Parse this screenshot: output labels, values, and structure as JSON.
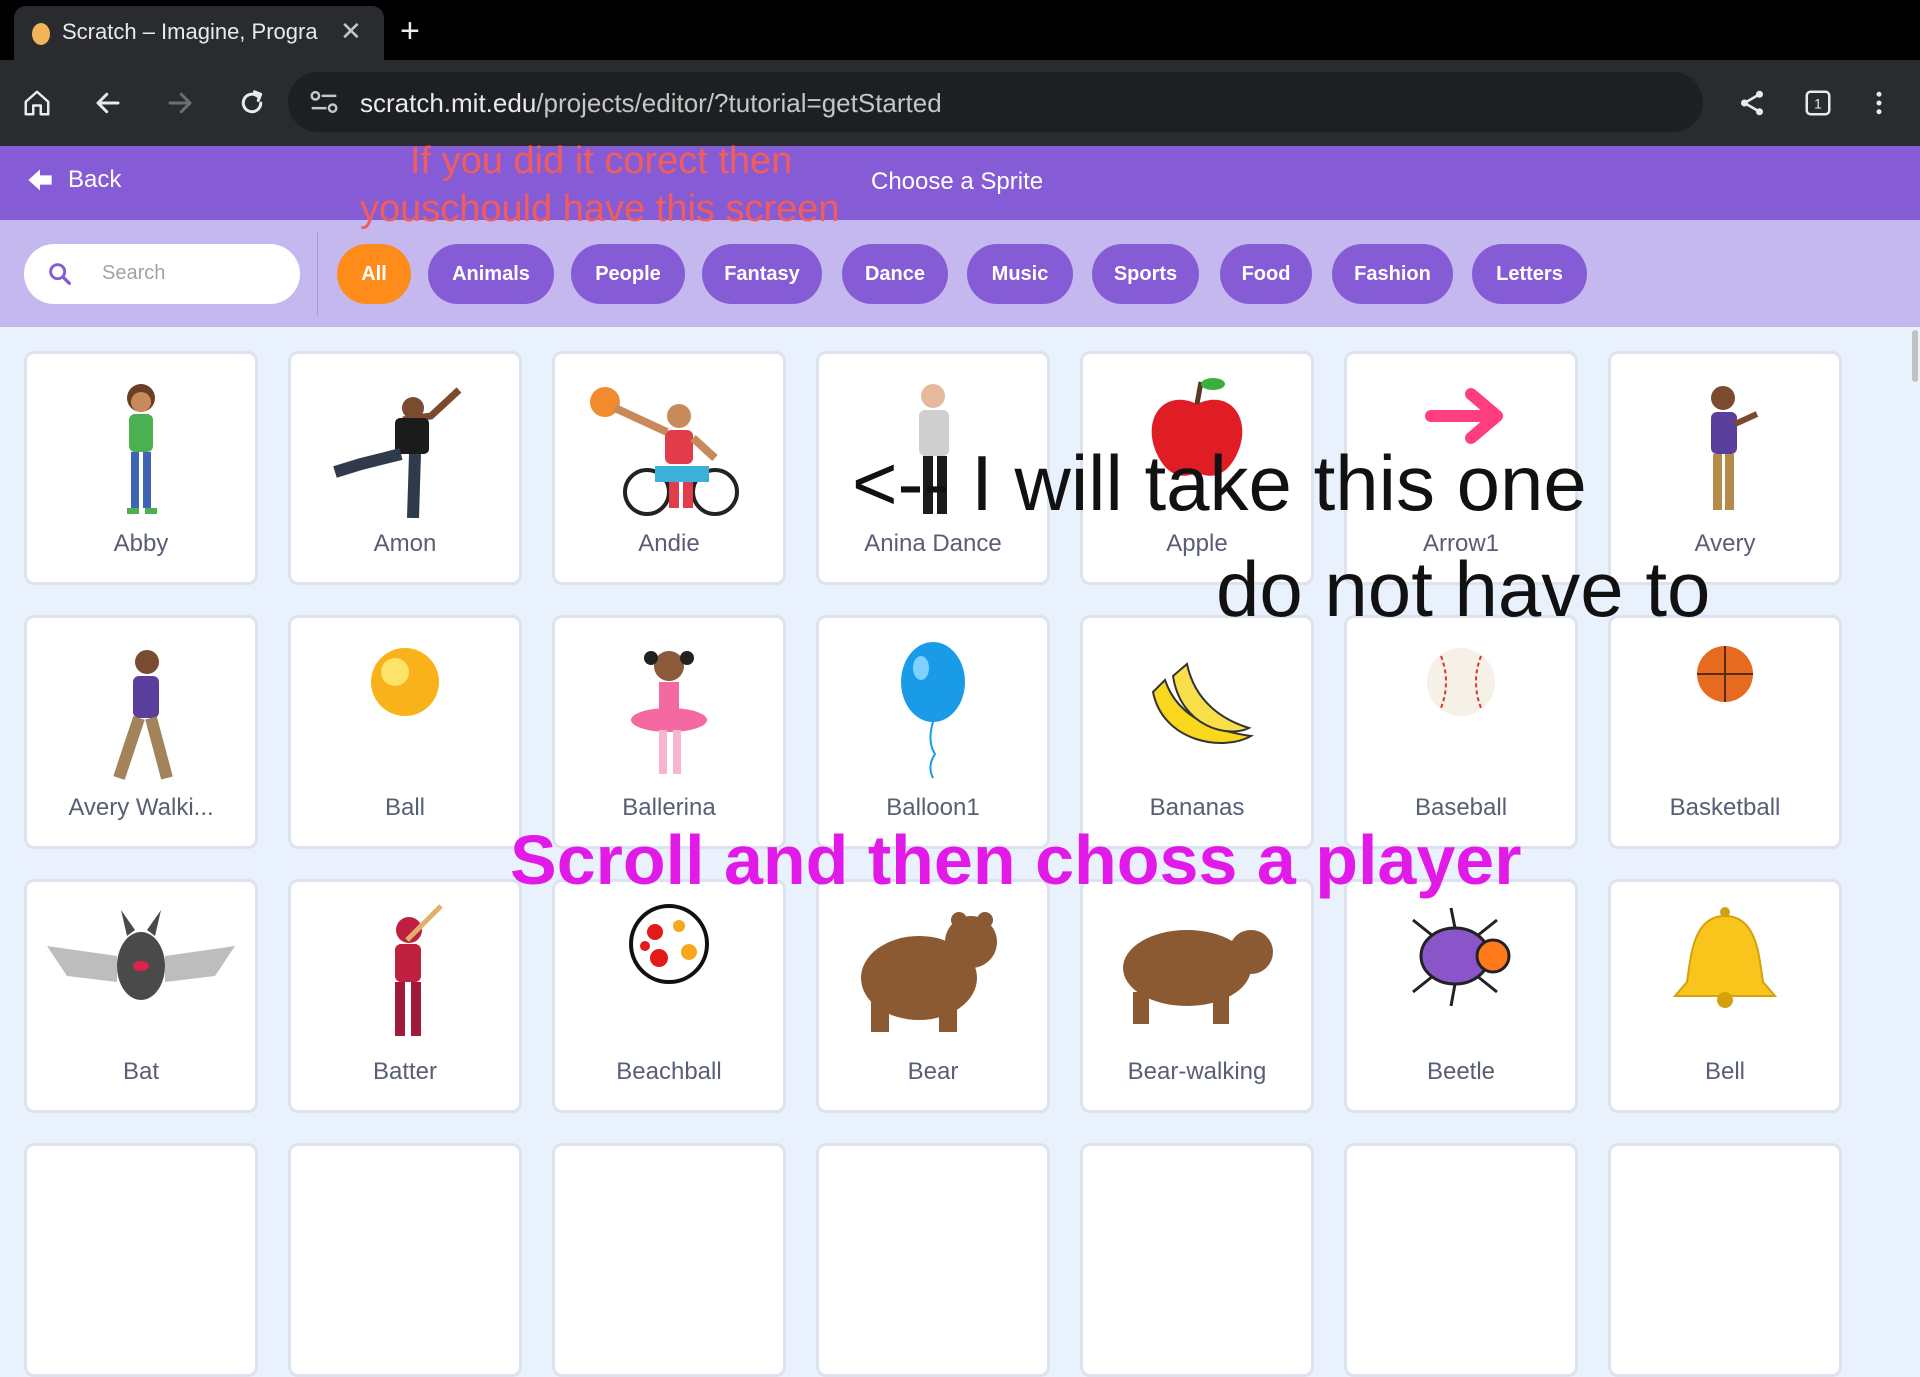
{
  "browser": {
    "tab_title": "Scratch – Imagine, Progra",
    "url_host": "scratch.mit.edu",
    "url_path": "/projects/editor/?tutorial=getStarted"
  },
  "header": {
    "back_label": "Back",
    "title": "Choose a Sprite"
  },
  "search": {
    "placeholder": "Search"
  },
  "filters": [
    "All",
    "Animals",
    "People",
    "Fantasy",
    "Dance",
    "Music",
    "Sports",
    "Food",
    "Fashion",
    "Letters"
  ],
  "active_filter": "All",
  "sprites": [
    "Abby",
    "Amon",
    "Andie",
    "Anina Dance",
    "Apple",
    "Arrow1",
    "Avery",
    "Avery Walki...",
    "Ball",
    "Ballerina",
    "Balloon1",
    "Bananas",
    "Baseball",
    "Basketball",
    "Bat",
    "Batter",
    "Beachball",
    "Bear",
    "Bear-walking",
    "Beetle",
    "Bell"
  ],
  "annotations": {
    "red_line1": "If you did it corect then",
    "red_line2": "youschould have this screen",
    "black_line1": "<-- I will take this one",
    "black_line2": "do not have to",
    "magenta": "Scroll and then choss a player"
  },
  "colors": {
    "header": "#855cd6",
    "filterbar": "#c5b8ef",
    "active_pill": "#ff8c1a",
    "annotation_red": "#f25c5c",
    "annotation_magenta": "#e21ae8"
  }
}
